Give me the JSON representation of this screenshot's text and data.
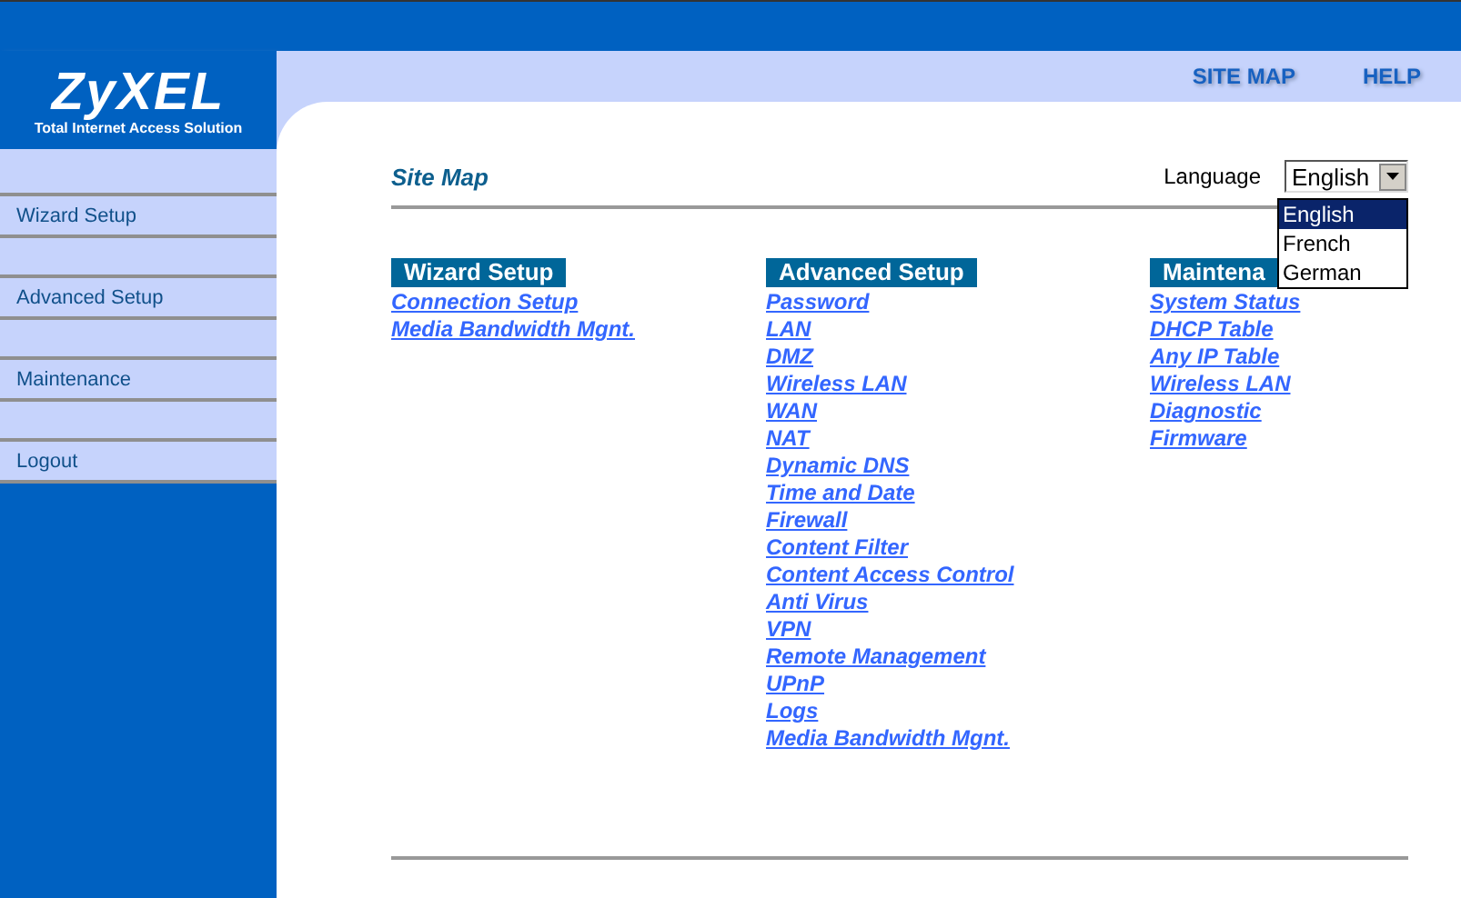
{
  "logo": {
    "name": "ZyXEL",
    "tagline": "Total Internet Access Solution"
  },
  "top_nav": [
    "SITE MAP",
    "HELP"
  ],
  "sidebar": {
    "items": [
      "Wizard Setup",
      "Advanced Setup",
      "Maintenance",
      "Logout"
    ]
  },
  "page_title": "Site Map",
  "language": {
    "label": "Language",
    "value": "English",
    "options": [
      {
        "label": "English",
        "selected": true
      },
      {
        "label": "French",
        "selected": false
      },
      {
        "label": "German",
        "selected": false
      }
    ]
  },
  "sections": [
    {
      "heading": "Wizard Setup",
      "links": [
        "Connection Setup",
        "Media Bandwidth Mgnt."
      ]
    },
    {
      "heading": "Advanced Setup",
      "links": [
        "Password",
        "LAN",
        "DMZ",
        "Wireless LAN",
        "WAN",
        "NAT",
        "Dynamic DNS",
        "Time and Date",
        "Firewall",
        "Content Filter",
        "Content Access Control",
        "Anti Virus",
        "VPN",
        "Remote Management",
        "UPnP",
        "Logs",
        "Media Bandwidth Mgnt."
      ]
    },
    {
      "heading": "Maintena",
      "links": [
        "System Status",
        "DHCP Table",
        "Any IP Table",
        "Wireless LAN",
        "Diagnostic",
        "Firmware"
      ]
    }
  ]
}
